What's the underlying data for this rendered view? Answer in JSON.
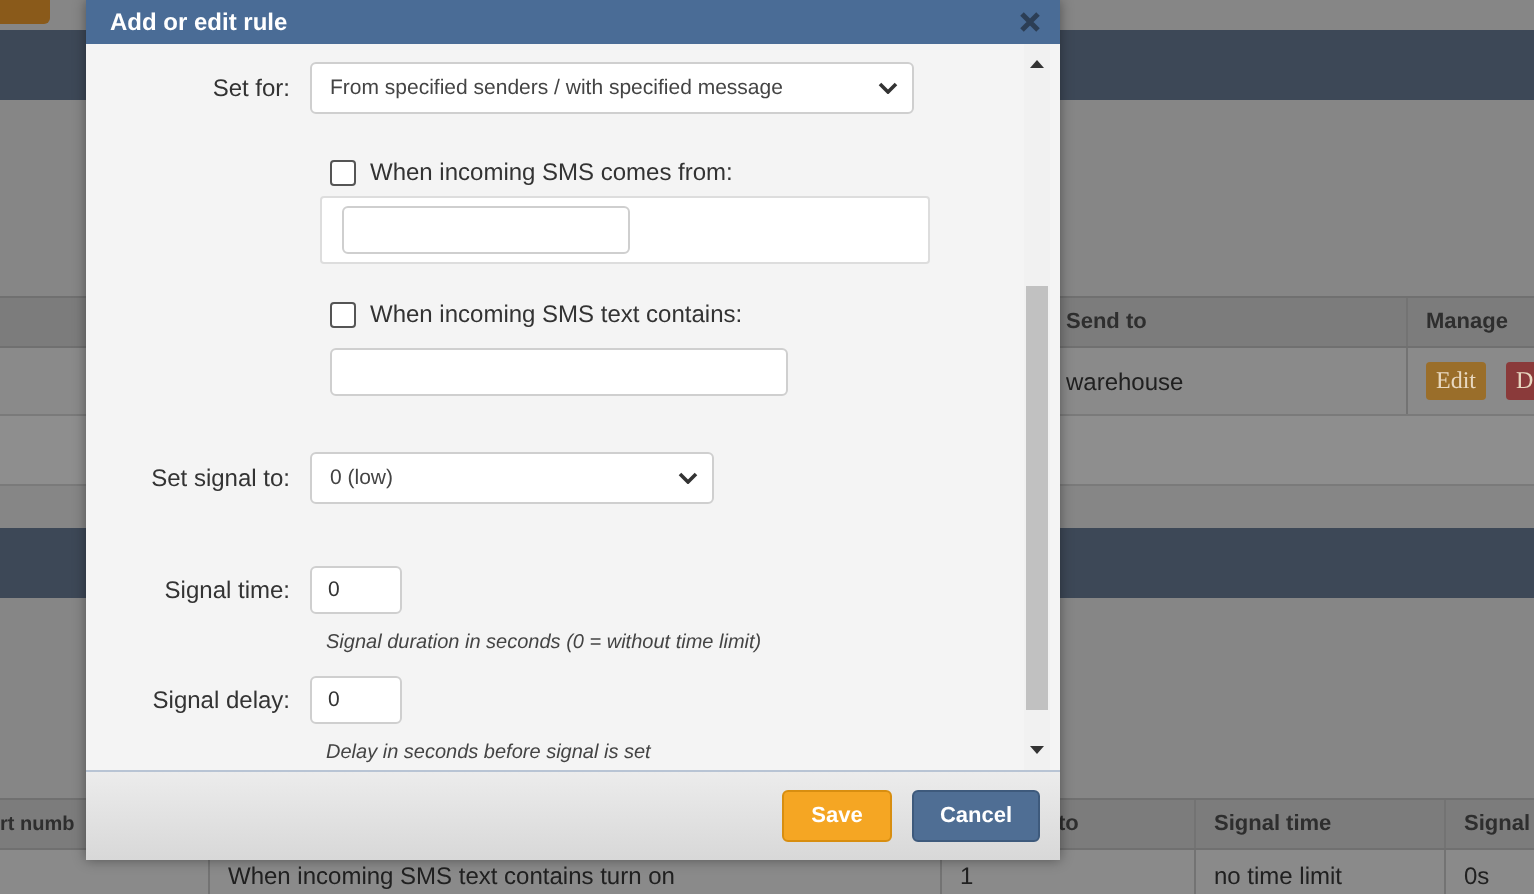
{
  "page": {
    "upper_table": {
      "columns": [
        "Send to",
        "Manage"
      ],
      "rows": [
        {
          "send_to": "warehouse",
          "actions": [
            {
              "label": "Edit",
              "kind": "edit"
            },
            {
              "label": "D",
              "kind": "delete"
            }
          ]
        }
      ]
    },
    "lower_table": {
      "columns": [
        "rt numb",
        "",
        "to",
        "Signal time",
        "Signal"
      ],
      "rows": [
        {
          "cells": [
            "",
            "When incoming SMS text contains turn on",
            "1",
            "no time limit",
            "0s"
          ]
        }
      ]
    }
  },
  "dialog": {
    "title": "Add or edit rule",
    "set_for": {
      "label": "Set for:",
      "value": "From specified senders / with specified message"
    },
    "conditions": [
      {
        "label": "When incoming SMS comes from:",
        "checked": false,
        "framed": true
      },
      {
        "label": "When incoming SMS text contains:",
        "checked": false,
        "framed": false
      }
    ],
    "signal": {
      "label": "Set signal to:",
      "value": "0 (low)"
    },
    "timings": [
      {
        "label": "Signal time:",
        "value": "0",
        "hint": "Signal duration in seconds (0 = without time limit)"
      },
      {
        "label": "Signal delay:",
        "value": "0",
        "hint": "Delay in seconds before signal is set"
      }
    ],
    "buttons": [
      {
        "label": "Save",
        "kind": "primary"
      },
      {
        "label": "Cancel",
        "kind": "secondary"
      }
    ]
  }
}
